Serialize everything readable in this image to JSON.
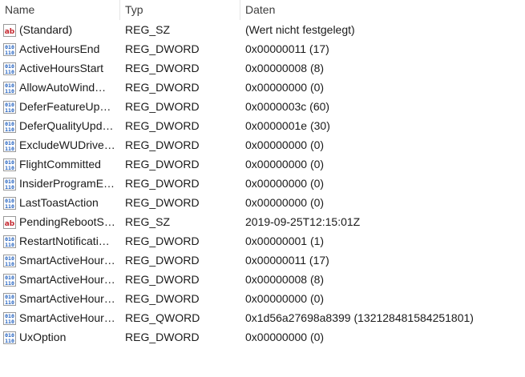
{
  "columns": {
    "name": "Name",
    "type": "Typ",
    "data": "Daten"
  },
  "rows": [
    {
      "name": "(Standard)",
      "type": "REG_SZ",
      "data": "(Wert nicht festgelegt)",
      "icon": "string-value-icon"
    },
    {
      "name": "ActiveHoursEnd",
      "type": "REG_DWORD",
      "data": "0x00000011 (17)",
      "icon": "binary-value-icon"
    },
    {
      "name": "ActiveHoursStart",
      "type": "REG_DWORD",
      "data": "0x00000008 (8)",
      "icon": "binary-value-icon"
    },
    {
      "name": "AllowAutoWind…",
      "type": "REG_DWORD",
      "data": "0x00000000 (0)",
      "icon": "binary-value-icon"
    },
    {
      "name": "DeferFeatureUp…",
      "type": "REG_DWORD",
      "data": "0x0000003c (60)",
      "icon": "binary-value-icon"
    },
    {
      "name": "DeferQualityUpd…",
      "type": "REG_DWORD",
      "data": "0x0000001e (30)",
      "icon": "binary-value-icon"
    },
    {
      "name": "ExcludeWUDrive…",
      "type": "REG_DWORD",
      "data": "0x00000000 (0)",
      "icon": "binary-value-icon"
    },
    {
      "name": "FlightCommitted",
      "type": "REG_DWORD",
      "data": "0x00000000 (0)",
      "icon": "binary-value-icon"
    },
    {
      "name": "InsiderProgramE…",
      "type": "REG_DWORD",
      "data": "0x00000000 (0)",
      "icon": "binary-value-icon"
    },
    {
      "name": "LastToastAction",
      "type": "REG_DWORD",
      "data": "0x00000000 (0)",
      "icon": "binary-value-icon"
    },
    {
      "name": "PendingRebootS…",
      "type": "REG_SZ",
      "data": "2019-09-25T12:15:01Z",
      "icon": "string-value-icon"
    },
    {
      "name": "RestartNotificati…",
      "type": "REG_DWORD",
      "data": "0x00000001 (1)",
      "icon": "binary-value-icon"
    },
    {
      "name": "SmartActiveHour…",
      "type": "REG_DWORD",
      "data": "0x00000011 (17)",
      "icon": "binary-value-icon"
    },
    {
      "name": "SmartActiveHour…",
      "type": "REG_DWORD",
      "data": "0x00000008 (8)",
      "icon": "binary-value-icon"
    },
    {
      "name": "SmartActiveHour…",
      "type": "REG_DWORD",
      "data": "0x00000000 (0)",
      "icon": "binary-value-icon"
    },
    {
      "name": "SmartActiveHour…",
      "type": "REG_QWORD",
      "data": "0x1d56a27698a8399 (132128481584251801)",
      "icon": "binary-value-icon"
    },
    {
      "name": "UxOption",
      "type": "REG_DWORD",
      "data": "0x00000000 (0)",
      "icon": "binary-value-icon"
    }
  ],
  "colors": {
    "string_icon_red": "#c4262e",
    "binary_icon_blue": "#1f5fbf"
  }
}
